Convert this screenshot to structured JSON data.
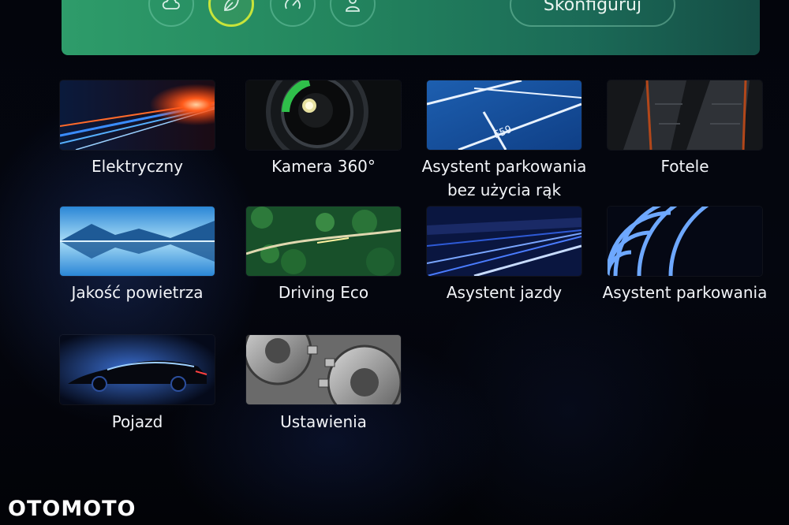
{
  "top_bar": {
    "modes": [
      {
        "icon": "cloud-icon"
      },
      {
        "icon": "leaf-icon",
        "active": true
      },
      {
        "icon": "gauge-icon"
      },
      {
        "icon": "person-icon"
      }
    ],
    "configure_label": "Skonfiguruj"
  },
  "apps": [
    {
      "label": "Elektryczny",
      "icon": "electric-speed-image"
    },
    {
      "label": "Kamera 360°",
      "icon": "camera-lens-image"
    },
    {
      "label": "Asystent parkowania bez użycia rąk",
      "icon": "parking-lot-image"
    },
    {
      "label": "Fotele",
      "icon": "seats-image"
    },
    {
      "label": "Jakość powietrza",
      "icon": "mountain-lake-image"
    },
    {
      "label": "Driving Eco",
      "icon": "forest-road-image"
    },
    {
      "label": "Asystent jazdy",
      "icon": "night-road-image"
    },
    {
      "label": "Asystent parkowania",
      "icon": "sensor-waves-image"
    },
    {
      "label": "Pojazd",
      "icon": "car-silhouette-image"
    },
    {
      "label": "Ustawienia",
      "icon": "gears-image"
    }
  ],
  "watermark": "OTOMOTO",
  "colors": {
    "accent": "#c7e43a",
    "bar_green": "#23855e"
  }
}
